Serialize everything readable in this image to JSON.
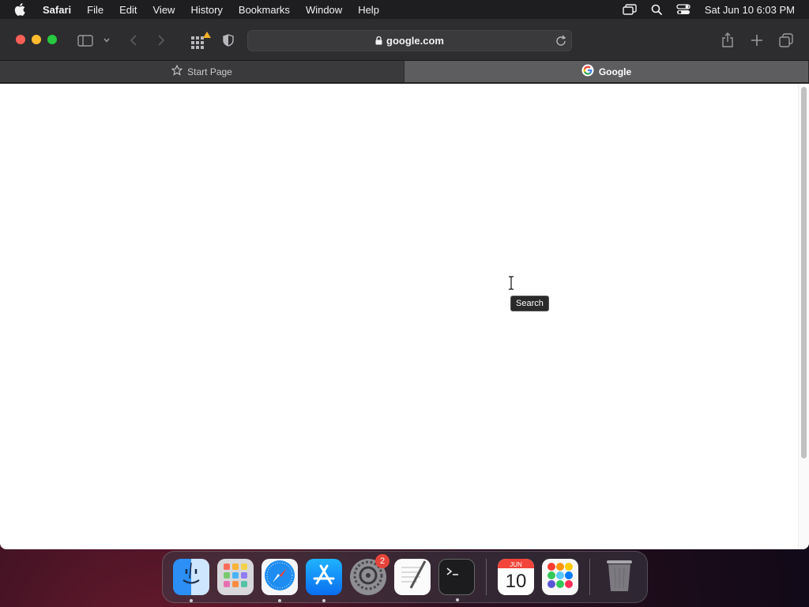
{
  "menubar": {
    "app_name": "Safari",
    "items": [
      "File",
      "Edit",
      "View",
      "History",
      "Bookmarks",
      "Window",
      "Help"
    ],
    "clock": "Sat Jun 10  6:03 PM"
  },
  "toolbar": {
    "url": "google.com"
  },
  "tabs": [
    {
      "label": "Start Page",
      "icon": "star-icon",
      "active": false
    },
    {
      "label": "Google",
      "icon": "google-icon",
      "active": true
    }
  ],
  "content": {
    "tooltip": "Search"
  },
  "dock": {
    "items": [
      {
        "name": "Finder",
        "icon": "finder-icon",
        "running": true
      },
      {
        "name": "Launchpad",
        "icon": "launchpad-icon",
        "running": false
      },
      {
        "name": "Safari",
        "icon": "safari-icon",
        "running": true
      },
      {
        "name": "App Store",
        "icon": "app-store-icon",
        "running": true
      },
      {
        "name": "System Preferences",
        "icon": "settings-icon",
        "running": false,
        "badge": "2"
      },
      {
        "name": "TextEdit",
        "icon": "textedit-icon",
        "running": false
      },
      {
        "name": "Terminal",
        "icon": "terminal-icon",
        "running": true
      },
      {
        "name": "Calendar",
        "icon": "calendar-icon",
        "running": false,
        "month": "JUN",
        "day": "10"
      },
      {
        "name": "Reminders",
        "icon": "reminders-icon",
        "running": false
      },
      {
        "name": "Trash",
        "icon": "trash-icon",
        "running": false
      }
    ]
  },
  "colors": {
    "close": "#ff5f57",
    "minimize": "#febc2e",
    "zoom": "#28c840",
    "tab_active": "#5d5d60"
  }
}
